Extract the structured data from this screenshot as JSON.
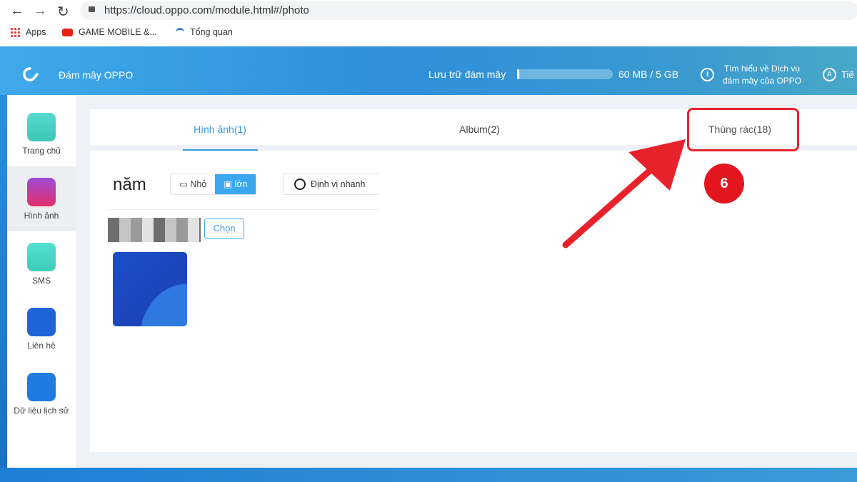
{
  "browser": {
    "url": "https://cloud.oppo.com/module.html#/photo",
    "bookmarks": [
      "Apps",
      "GAME MOBILE &...",
      "Tổng quan"
    ]
  },
  "header": {
    "brand": "Đám mây OPPO",
    "storage_label": "Lưu trữ đám mây",
    "storage_used": "60 MB / 5 GB",
    "storage_fraction": 0.012,
    "learn_line1": "Tìm hiểu về Dịch vụ",
    "learn_line2": "đám mây của OPPO",
    "more": "Tiế"
  },
  "sidebar": {
    "items": [
      {
        "label": "Trang chủ",
        "color": "#3fd4c0"
      },
      {
        "label": "Hình ảnh",
        "color": "#d8307a"
      },
      {
        "label": "SMS",
        "color": "#45dcc8"
      },
      {
        "label": "Liên hệ",
        "color": "#1f63d8"
      },
      {
        "label": "Dữ liệu lịch sử",
        "color": "#1e7be0"
      }
    ]
  },
  "tabs": [
    {
      "label": "Hình ảnh(1)"
    },
    {
      "label": "Album(2)"
    },
    {
      "label": "Thùng rác(18)"
    }
  ],
  "toolbar": {
    "year": "năm",
    "small": "Nhỏ",
    "large": "lớn",
    "quick": "Định vị nhanh"
  },
  "group": {
    "choose": "Chọn"
  },
  "annotation": {
    "step": "6",
    "color": "#e8222b"
  }
}
